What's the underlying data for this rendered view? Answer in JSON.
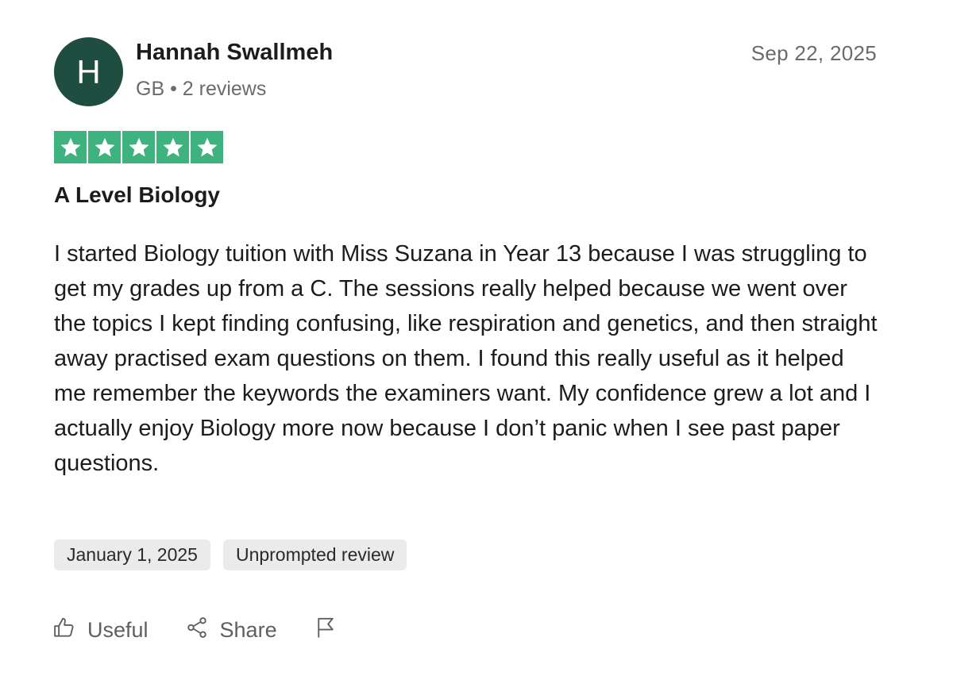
{
  "reviewer": {
    "initial": "H",
    "name": "Hannah Swallmeh",
    "meta": "GB • 2 reviews",
    "avatar_color": "#1f4d40"
  },
  "review_date": "Sep 22, 2025",
  "rating": {
    "value": 5,
    "max": 5,
    "star_color": "#3fb37f"
  },
  "review": {
    "title": "A Level Biology",
    "text": "I started Biology tuition with Miss Suzana in Year 13 because I was struggling to get my grades up from a C. The sessions really helped because we went over the topics I kept finding confusing, like respiration and genetics, and then straight away practised exam questions on them. I found this really useful as it helped me remember the keywords the examiners want. My confidence grew a lot and I actually enjoy Biology more now because I don’t panic when I see past paper questions."
  },
  "tags": {
    "experience_date": "January 1, 2025",
    "review_type": "Unprompted review"
  },
  "actions": {
    "useful_label": "Useful",
    "share_label": "Share",
    "useful_icon": "thumbs-up-icon",
    "share_icon": "share-icon",
    "report_icon": "flag-icon"
  }
}
